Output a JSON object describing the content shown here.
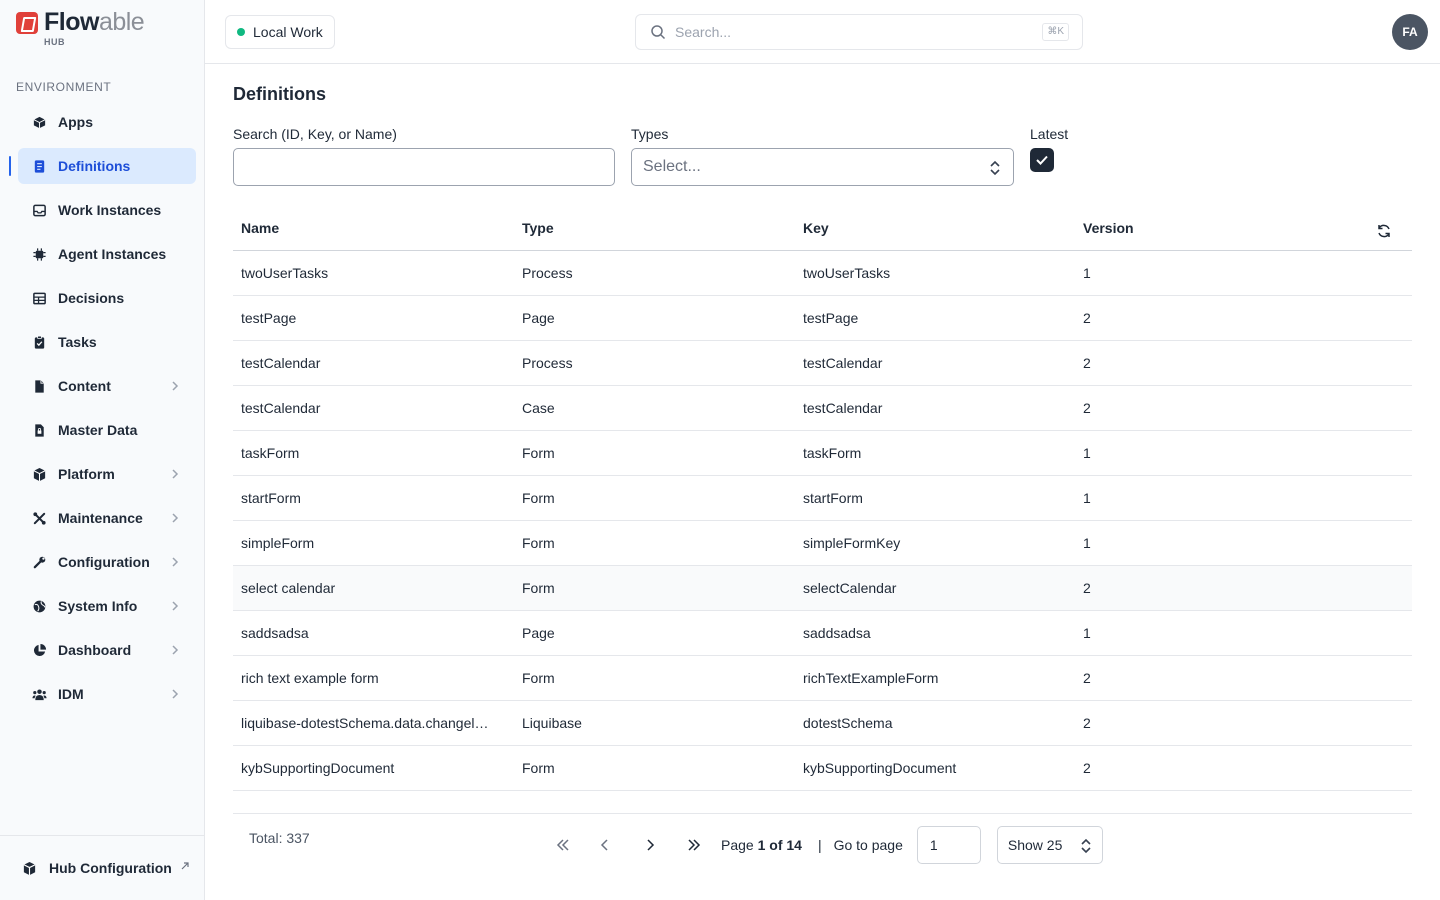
{
  "brand": {
    "name_part1": "Flow",
    "name_part2": "able",
    "sub": "HUB"
  },
  "sidebar": {
    "section_label": "ENVIRONMENT",
    "items": [
      {
        "label": "Apps",
        "icon": "apps-icon",
        "active": false,
        "has_chevron": false
      },
      {
        "label": "Definitions",
        "icon": "definitions-icon",
        "active": true,
        "has_chevron": false
      },
      {
        "label": "Work Instances",
        "icon": "inbox-icon",
        "active": false,
        "has_chevron": false
      },
      {
        "label": "Agent Instances",
        "icon": "chip-icon",
        "active": false,
        "has_chevron": false
      },
      {
        "label": "Decisions",
        "icon": "table-icon",
        "active": false,
        "has_chevron": false
      },
      {
        "label": "Tasks",
        "icon": "clipboard-check-icon",
        "active": false,
        "has_chevron": false
      },
      {
        "label": "Content",
        "icon": "file-icon",
        "active": false,
        "has_chevron": true
      },
      {
        "label": "Master Data",
        "icon": "file-lock-icon",
        "active": false,
        "has_chevron": false
      },
      {
        "label": "Platform",
        "icon": "cube-icon",
        "active": false,
        "has_chevron": true
      },
      {
        "label": "Maintenance",
        "icon": "tools-icon",
        "active": false,
        "has_chevron": true
      },
      {
        "label": "Configuration",
        "icon": "wrench-icon",
        "active": false,
        "has_chevron": true
      },
      {
        "label": "System Info",
        "icon": "globe-icon",
        "active": false,
        "has_chevron": true
      },
      {
        "label": "Dashboard",
        "icon": "pie-chart-icon",
        "active": false,
        "has_chevron": true
      },
      {
        "label": "IDM",
        "icon": "users-icon",
        "active": false,
        "has_chevron": true
      }
    ],
    "footer": {
      "label": "Hub Configuration",
      "icon": "cube-icon"
    }
  },
  "topbar": {
    "workspace": "Local Work",
    "search_placeholder": "Search...",
    "shortcut": "⌘K",
    "avatar_initials": "FA"
  },
  "main": {
    "title": "Definitions",
    "filters": {
      "search_label": "Search (ID, Key, or Name)",
      "search_value": "",
      "types_label": "Types",
      "types_placeholder": "Select...",
      "latest_label": "Latest",
      "latest_checked": true
    },
    "table": {
      "columns": [
        "Name",
        "Type",
        "Key",
        "Version"
      ],
      "rows": [
        [
          "twoUserTasks",
          "Process",
          "twoUserTasks",
          "1"
        ],
        [
          "testPage",
          "Page",
          "testPage",
          "2"
        ],
        [
          "testCalendar",
          "Process",
          "testCalendar",
          "2"
        ],
        [
          "testCalendar",
          "Case",
          "testCalendar",
          "2"
        ],
        [
          "taskForm",
          "Form",
          "taskForm",
          "1"
        ],
        [
          "startForm",
          "Form",
          "startForm",
          "1"
        ],
        [
          "simpleForm",
          "Form",
          "simpleFormKey",
          "1"
        ],
        [
          "select calendar",
          "Form",
          "selectCalendar",
          "2"
        ],
        [
          "saddsadsa",
          "Page",
          "saddsadsa",
          "1"
        ],
        [
          "rich text example form",
          "Form",
          "richTextExampleForm",
          "2"
        ],
        [
          "liquibase-dotestSchema.data.changel…",
          "Liquibase",
          "dotestSchema",
          "2"
        ],
        [
          "kybSupportingDocument",
          "Form",
          "kybSupportingDocument",
          "2"
        ]
      ],
      "highlighted_row": 7
    },
    "pagination": {
      "total": "Total: 337",
      "page_prefix": "Page ",
      "page_current": "1 of 14",
      "separator": "|",
      "goto_label": "Go to page",
      "goto_value": "1",
      "show_value": "Show 25"
    }
  },
  "colors": {
    "accent": "#2563eb",
    "active_bg": "#dbeafe",
    "status_dot": "#10b981",
    "brand_red": "#e0403a"
  }
}
